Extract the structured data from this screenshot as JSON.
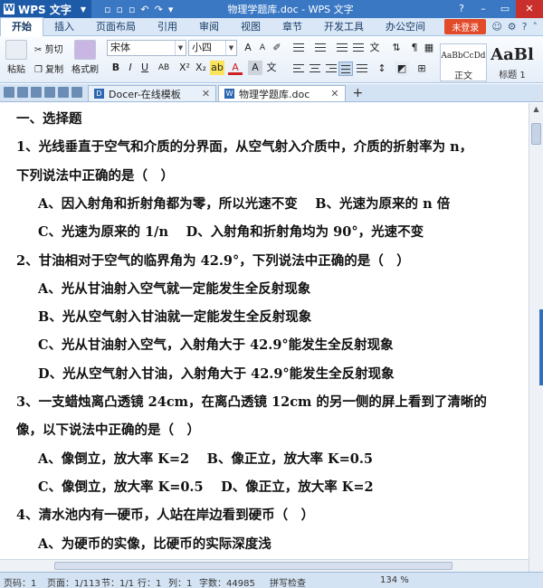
{
  "titlebar": {
    "app_name": "WPS 文字",
    "doc_title": "物理学题库.doc - WPS 文字",
    "tools": [
      "▫",
      "▫",
      "▫",
      "↶",
      "↷",
      "▾"
    ],
    "controls": [
      "?",
      "–",
      "▭",
      "✕"
    ]
  },
  "menu": {
    "tabs": [
      "开始",
      "插入",
      "页面布局",
      "引用",
      "审阅",
      "视图",
      "章节",
      "开发工具",
      "办公空间"
    ],
    "login": "未登录"
  },
  "ribbon": {
    "paste": "粘贴",
    "cut": "剪切",
    "copy": "复制",
    "format_painter": "格式刷",
    "font_name": "宋体",
    "font_size": "小四",
    "style_normal_preview": "AaBbCcDd",
    "style_normal": "正文",
    "style_heading_preview": "AaBl",
    "style_heading": "标题 1"
  },
  "tabs": {
    "docer": "Docer-在线模板",
    "current": "物理学题库.doc",
    "new_tab": "+"
  },
  "document": {
    "lines": [
      {
        "text": "一、选择题",
        "indent": false
      },
      {
        "text": "1、光线垂直于空气和介质的分界面，从空气射入介质中，介质的折射率为 n，",
        "indent": false
      },
      {
        "text": "下列说法中正确的是（　）",
        "indent": false
      },
      {
        "text": "A、因入射角和折射角都为零，所以光速不变　 B、光速为原来的 n 倍",
        "indent": true
      },
      {
        "text": "C、光速为原来的 1/n　 D、入射角和折射角均为 90°，光速不变",
        "indent": true
      },
      {
        "text": "2、甘油相对于空气的临界角为 42.9°，下列说法中正确的是（　）",
        "indent": false
      },
      {
        "text": "A、光从甘油射入空气就一定能发生全反射现象",
        "indent": true
      },
      {
        "text": "B、光从空气射入甘油就一定能发生全反射现象",
        "indent": true
      },
      {
        "text": "C、光从甘油射入空气，入射角大于 42.9°能发生全反射现象",
        "indent": true
      },
      {
        "text": "D、光从空气射入甘油，入射角大于 42.9°能发生全反射现象",
        "indent": true
      },
      {
        "text": "3、一支蜡烛离凸透镜 24cm，在离凸透镜 12cm 的另一侧的屏上看到了清晰的",
        "indent": false
      },
      {
        "text": "像，以下说法中正确的是（　）",
        "indent": false
      },
      {
        "text": "A、像倒立，放大率 K=2　 B、像正立，放大率 K=0.5",
        "indent": true
      },
      {
        "text": "C、像倒立，放大率 K=0.5　 D、像正立，放大率 K=2",
        "indent": true
      },
      {
        "text": "4、清水池内有一硬币，人站在岸边看到硬币（　）",
        "indent": false
      },
      {
        "text": "A、为硬币的实像，比硬币的实际深度浅",
        "indent": true
      }
    ]
  },
  "status": {
    "page": "页码：1",
    "pages": "页面：1/113",
    "section": "节：1/1",
    "row": "行：1",
    "col": "列：1",
    "words": "字数：44985",
    "spell": "拼写检查",
    "zoom": "134 %"
  }
}
